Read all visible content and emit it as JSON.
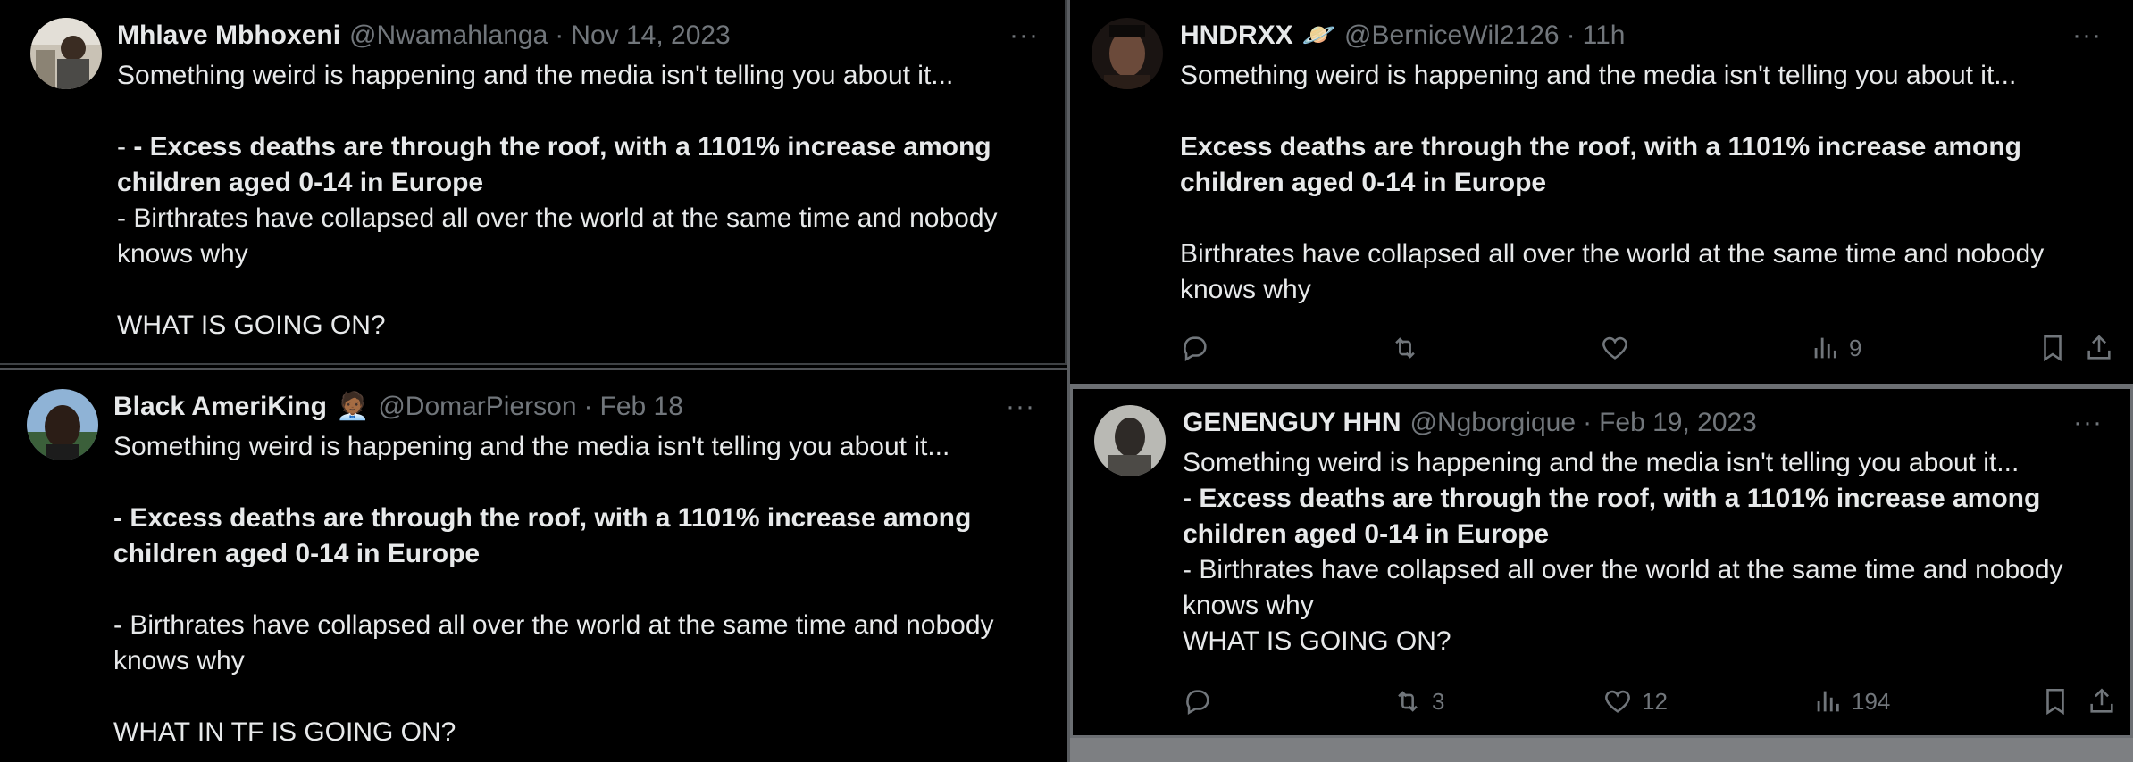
{
  "tweets": [
    {
      "name": "Mhlave Mbhoxeni",
      "handle": "@Nwamahlanga",
      "sep": "·",
      "time": "Nov 14, 2023",
      "more": "···",
      "lines": [
        "Something weird is happening and the media isn't telling you about it...",
        "- Excess deaths are through the roof, with a 1101% increase among",
        "children aged 0-14 in Europe",
        "- Birthrates have collapsed all over the world at the same time and nobody",
        "knows why",
        "WHAT IS GOING ON?"
      ],
      "bold_prefix": "- "
    },
    {
      "name": "Black AmeriKing",
      "emoji": "🧑🏾‍💼",
      "handle": "@DomarPierson",
      "sep": "·",
      "time": "Feb 18",
      "more": "···",
      "lines": [
        "Something weird is happening and the media isn't telling you about it...",
        "Excess deaths are through the roof, with a 1101% increase among",
        "children aged 0-14 in Europe",
        "- Birthrates have collapsed all over the world at the same time and nobody",
        "knows why",
        "WHAT IN TF IS GOING ON?"
      ],
      "bold_prefix": "- "
    },
    {
      "name": "HNDRXX",
      "emoji": "🪐",
      "handle": "@BerniceWil2126",
      "sep": "·",
      "time": "11h",
      "more": "···",
      "lines": [
        "Something weird is happening and the media isn't telling you about it...",
        "Excess deaths are through the roof, with a 1101% increase among",
        "children aged 0-14 in Europe",
        "Birthrates have collapsed all over the world at the same time and nobody",
        "knows why"
      ],
      "actions": {
        "reply": "",
        "retweet": "",
        "like": "",
        "views": "9"
      }
    },
    {
      "name": "GENENGUY HHN",
      "handle": "@Ngborgique",
      "sep": "·",
      "time": "Feb 19, 2023",
      "more": "···",
      "lines": [
        "Something weird is happening and the media isn't telling you about it...",
        "Excess deaths are through the roof, with a 1101% increase among",
        "children aged 0-14 in Europe",
        "- Birthrates have collapsed all over the world at the same time and nobody",
        "knows why",
        "WHAT IS GOING ON?"
      ],
      "bold_prefix": "- ",
      "actions": {
        "reply": "",
        "retweet": "3",
        "like": "12",
        "views": "194"
      }
    }
  ],
  "colors": {
    "text": "#e7e9ea",
    "muted": "#71767b",
    "background": "#000000"
  },
  "icons": [
    "reply-icon",
    "retweet-icon",
    "like-icon",
    "views-icon",
    "bookmark-icon",
    "share-icon",
    "more-icon"
  ]
}
